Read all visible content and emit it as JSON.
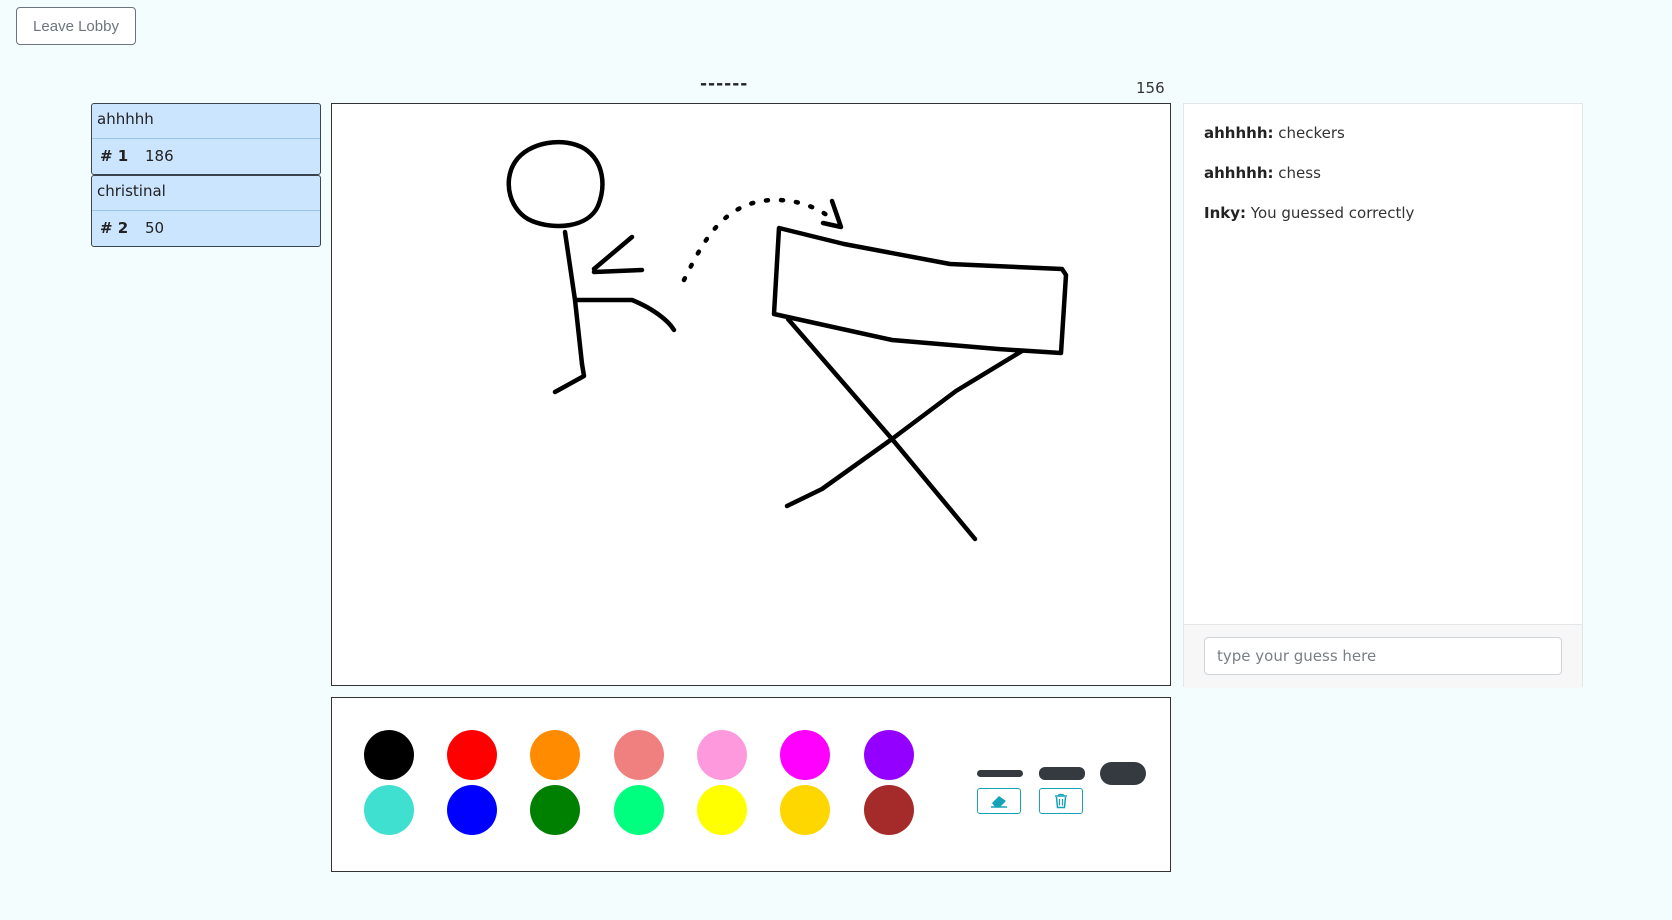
{
  "header": {
    "leave_label": "Leave Lobby",
    "word_hint": "------",
    "timer": "156"
  },
  "players": [
    {
      "name": "ahhhhh",
      "rank": "# 1",
      "score": "186"
    },
    {
      "name": "christinal",
      "rank": "# 2",
      "score": "50"
    }
  ],
  "palette": {
    "colors": [
      "#000000",
      "#ff0000",
      "#ff8c00",
      "#f08080",
      "#ff99dd",
      "#ff00ff",
      "#9400ff",
      "#40e0d0",
      "#0000ff",
      "#008000",
      "#00ff7f",
      "#ffff00",
      "#ffd700",
      "#a52a2a"
    ]
  },
  "tools": {
    "brush_sizes": [
      "small",
      "medium",
      "large"
    ],
    "eraser_icon": "eraser-icon",
    "clear_icon": "trash-icon",
    "accent_color": "#17a2b8"
  },
  "chat": {
    "messages": [
      {
        "author": "ahhhhh:",
        "text": " checkers"
      },
      {
        "author": "ahhhhh:",
        "text": " chess"
      },
      {
        "author": "Inky:",
        "text": " You guessed correctly"
      }
    ],
    "placeholder": "type your guess here"
  }
}
